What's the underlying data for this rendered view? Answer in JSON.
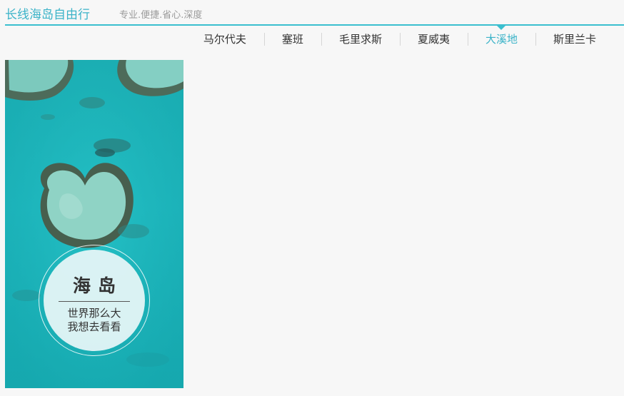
{
  "header": {
    "brand": "长线海岛自由行",
    "slogan": "专业.便捷.省心.深度"
  },
  "nav": {
    "items": [
      {
        "label": "马尔代夫",
        "active": false
      },
      {
        "label": "塞班",
        "active": false
      },
      {
        "label": "毛里求斯",
        "active": false
      },
      {
        "label": "夏威夷",
        "active": false
      },
      {
        "label": "大溪地",
        "active": true
      },
      {
        "label": "斯里兰卡",
        "active": false
      }
    ]
  },
  "banner": {
    "title": "海岛",
    "line1": "世界那么大",
    "line2": "我想去看看"
  },
  "colors": {
    "accent": "#3bbfcf",
    "sea": "#1eb3b8"
  }
}
